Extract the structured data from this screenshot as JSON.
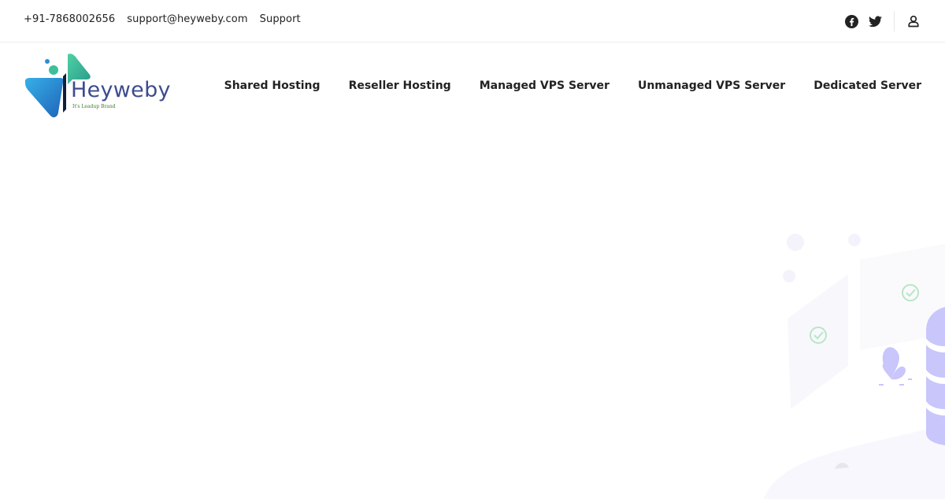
{
  "topbar": {
    "phone": "+91-7868002656",
    "email": "support@heyweby.com",
    "support_label": "Support",
    "icons": [
      "facebook-icon",
      "twitter-icon",
      "user-account-icon"
    ]
  },
  "header": {
    "logo": {
      "brand": "Heyweby",
      "tagline": "It's Leadup Brand"
    },
    "nav": [
      {
        "label": "Shared Hosting"
      },
      {
        "label": "Reseller Hosting"
      },
      {
        "label": "Managed VPS Server"
      },
      {
        "label": "Unmanaged VPS Server"
      },
      {
        "label": "Dedicated Server"
      }
    ]
  },
  "colors": {
    "brand_text": "#3d4c8f",
    "tagline": "#3b7d2b",
    "logo_teal": "#3cbf9a",
    "logo_blue": "#2a8fd6",
    "illustration_purple": "#c8c6fb",
    "check_green": "#b7e6c6"
  }
}
